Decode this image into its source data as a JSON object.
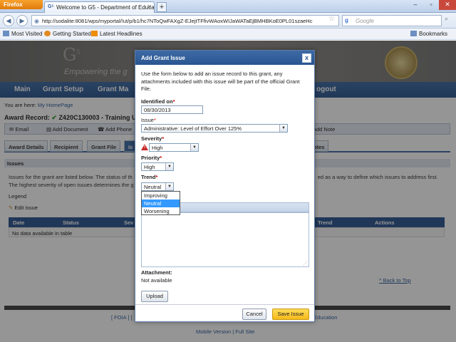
{
  "browser": {
    "app_button": "Firefox",
    "tab_title": "Welcome to G5 - Department of Educatio...",
    "url": "http://sodalite:8081/wps/myportal/!ut/p/b1/hc7NToQwFAXgZ-EJejtTFfivWAoxWIJaWATaEjBMHBKoE0PL01szaeHc",
    "search_placeholder": "Google",
    "bookmarks": [
      "Most Visited",
      "Getting Started",
      "Latest Headlines"
    ],
    "bookmarks_menu": "Bookmarks"
  },
  "portal": {
    "logo": "G",
    "logo_sup": "5",
    "tagline": "Empowering the g",
    "nav": [
      "Main",
      "Grant Setup",
      "Grant Ma",
      "ogout"
    ],
    "breadcrumb_prefix": "You are here:",
    "breadcrumb_link": "My HomePage",
    "award_record": "Award Record:",
    "award_id": "Z420C130003 - Training Ur",
    "toolbar": [
      "Email",
      "Add Document",
      "Add Phone",
      "Add Note"
    ],
    "tabs": [
      "Award Details",
      "Recipient",
      "Grant File",
      "Is",
      "otes"
    ],
    "issues_header": "Issues",
    "issues_desc_1": "Issues for the grant are listed below. The status of th",
    "issues_desc_1b": "ed as a way to define which issues to address first.",
    "issues_desc_2": "The highest severity of open issues determines the g",
    "legend": "Legend",
    "edit_issue": "Edit issue",
    "grid_columns": [
      "Date",
      "Status",
      "Sev",
      "Trend",
      "Actions"
    ],
    "no_data": "No data available in table",
    "back_to_top": "^ Back to Top",
    "footer_links": "[ FOIA ] [",
    "footer_right": "Education",
    "footer_mobile": "Mobile Version | Full Site"
  },
  "dialog": {
    "title": "Add Grant Issue",
    "close": "x",
    "intro": "Use the form below to add an issue record to this grant, any attachments included with this issue will be part of the official Grant File.",
    "identified_on_label": "Identified on",
    "identified_on_value": "08/30/2013",
    "issue_label": "Issue",
    "issue_value": "Administrative: Level of Effort Over 125%",
    "severity_label": "Severity",
    "severity_value": "High",
    "priority_label": "Priority",
    "priority_value": "High",
    "trend_label": "Trend",
    "trend_value": "Neutral",
    "trend_options": [
      "Improving",
      "Neutral",
      "Worsening"
    ],
    "trend_selected": "Neutral",
    "attachment_label": "Attachment:",
    "attachment_value": "Not available",
    "upload_button": "Upload",
    "cancel_button": "Cancel",
    "save_button": "Save Issue",
    "required_marker": "*"
  }
}
